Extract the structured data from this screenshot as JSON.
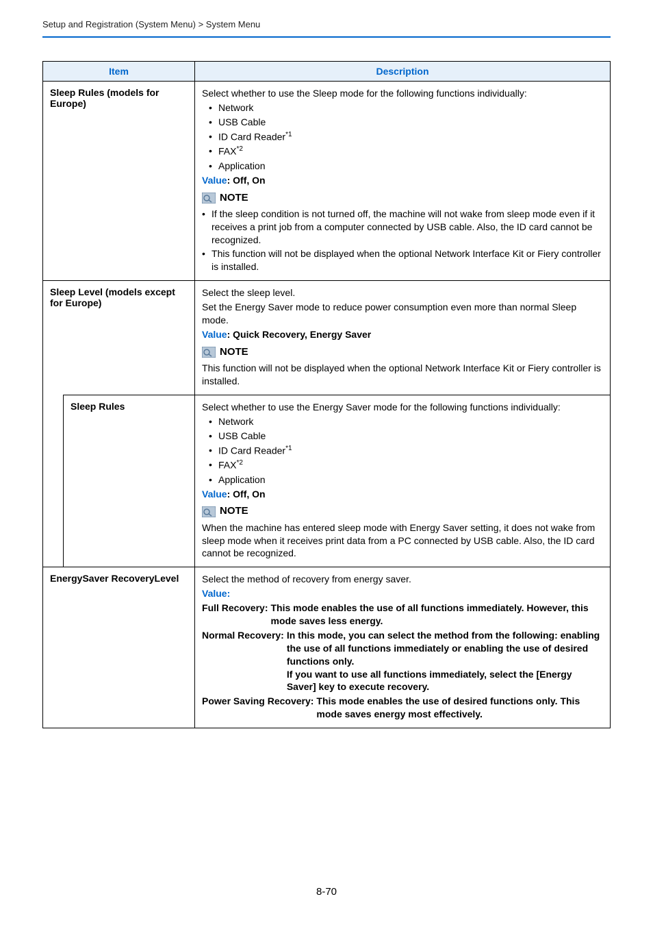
{
  "breadcrumb": "Setup and Registration (System Menu) > System Menu",
  "page_number": "8-70",
  "table": {
    "headers": {
      "item": "Item",
      "description": "Description"
    },
    "rows": [
      {
        "item": "Sleep Rules (models for Europe)",
        "desc": {
          "intro": "Select whether to use the Sleep mode for the following functions individually:",
          "bullets": [
            "Network",
            "USB Cable",
            "ID Card Reader",
            "FAX",
            "Application"
          ],
          "sup1": "*1",
          "sup2": "*2",
          "value_label": "Value",
          "value_text": ": Off, On",
          "note_label": "NOTE",
          "notes": [
            "If the sleep condition is not turned off, the machine will not wake from sleep mode even if it receives a print job from a computer connected by USB cable. Also, the ID card cannot be recognized.",
            "This function will not be displayed when the optional Network Interface Kit or Fiery controller is installed."
          ]
        }
      },
      {
        "item": "Sleep Level (models except for Europe)",
        "desc": {
          "line1": "Select the sleep level.",
          "line2": "Set the Energy Saver mode to reduce power consumption even more than normal Sleep mode.",
          "value_label": "Value",
          "value_text": ": Quick Recovery, Energy Saver",
          "note_label": "NOTE",
          "note_body": "This function will not be displayed when the optional Network Interface Kit or Fiery controller is installed."
        }
      },
      {
        "item": "Sleep Rules",
        "desc": {
          "intro": "Select whether to use the Energy Saver mode for the following functions individually:",
          "bullets": [
            "Network",
            "USB Cable",
            "ID Card Reader",
            "FAX",
            "Application"
          ],
          "sup1": "*1",
          "sup2": "*2",
          "value_label": "Value",
          "value_text": ": Off, On",
          "note_label": "NOTE",
          "note_body": "When the machine has entered sleep mode with Energy Saver setting, it does not wake from sleep mode when it receives print data from a PC connected by USB cable. Also, the ID card cannot be recognized."
        }
      },
      {
        "item": "EnergySaver RecoveryLevel",
        "desc": {
          "intro": "Select the method of recovery from energy saver.",
          "value_label": "Value",
          "value_colon": ":",
          "entries": [
            {
              "k": "Full Recovery:",
              "v": "This mode enables the use of all functions immediately. However, this mode saves less energy."
            },
            {
              "k": "Normal Recovery:",
              "v": "In this mode, you can select the method from the following: enabling the use of all functions immediately or enabling the use of desired functions only.\nIf you want to use all functions immediately, select the [Energy Saver] key to execute recovery."
            },
            {
              "k": "Power Saving Recovery:",
              "v": "This mode enables the use of desired functions only. This mode saves energy most effectively."
            }
          ]
        }
      }
    ]
  }
}
